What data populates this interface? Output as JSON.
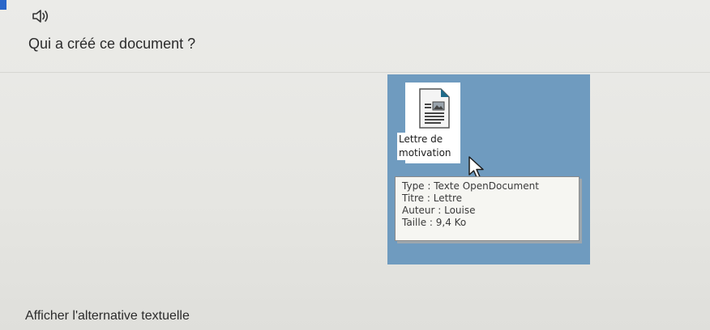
{
  "question": "Qui a créé ce document ?",
  "audio_icon": "speaker-icon",
  "accent_color": "#2a67c9",
  "illustration": {
    "background_color": "#6f9bbf",
    "file_icon": "writer-document-icon",
    "file_label_line1": "Lettre de",
    "file_label_line2": "motivation",
    "cursor_icon": "mouse-pointer-icon",
    "tooltip": {
      "type": "Type : Texte OpenDocument",
      "title": "Titre : Lettre",
      "author": "Auteur : Louise",
      "size": "Taille : 9,4 Ko"
    }
  },
  "alt_text_link": "Afficher l'alternative textuelle"
}
